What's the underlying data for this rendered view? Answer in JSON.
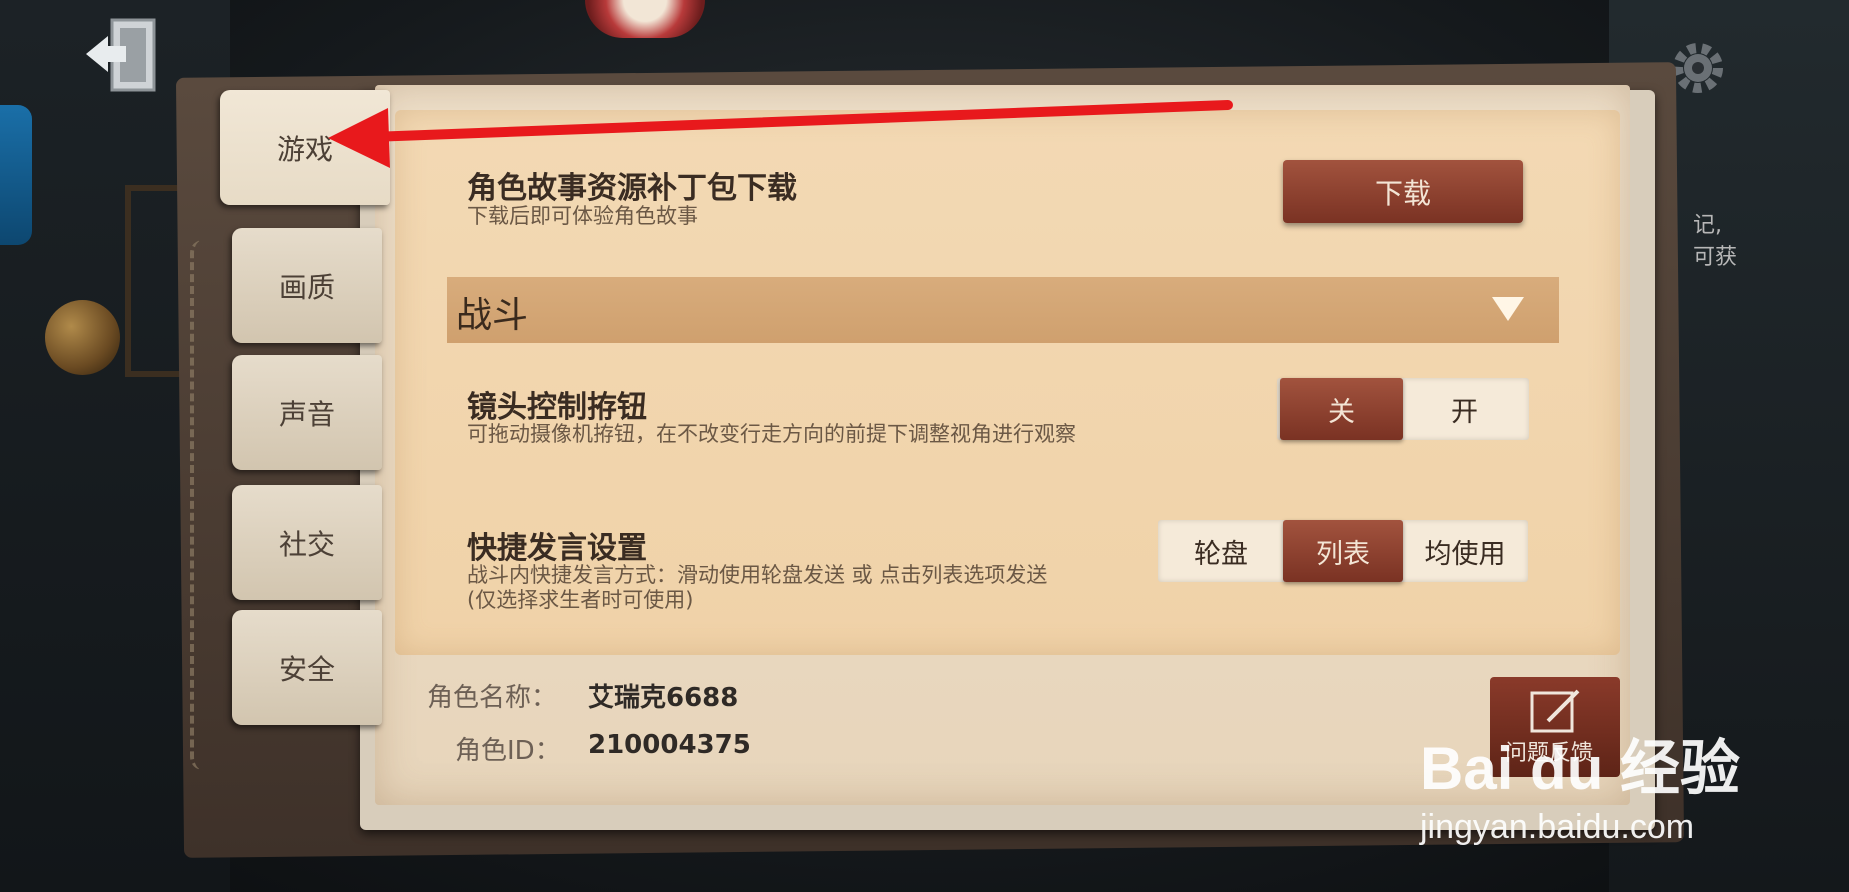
{
  "side_tabs": [
    {
      "label": "游戏",
      "active": true
    },
    {
      "label": "画质",
      "active": false
    },
    {
      "label": "声音",
      "active": false
    },
    {
      "label": "社交",
      "active": false
    },
    {
      "label": "安全",
      "active": false
    }
  ],
  "settings": {
    "story_patch": {
      "title": "角色故事资源补丁包下载",
      "description": "下载后即可体验角色故事",
      "button_label": "下载"
    },
    "section_title": "战斗",
    "camera_joystick": {
      "title": "镜头控制拵钮",
      "description": "可拖动摄像机拵钮，在不改变行走方向的前提下调整视角进行观察",
      "options": [
        "关",
        "开"
      ],
      "selected": "关"
    },
    "quick_chat": {
      "title": "快捷发言设置",
      "description_line1": "战斗内快捷发言方式：滑动使用轮盘发送 或 点击列表选项发送",
      "description_line2": "(仅选择求生者时可使用)",
      "options": [
        "轮盘",
        "列表",
        "均使用"
      ],
      "selected": "列表"
    }
  },
  "footer": {
    "name_label": "角色名称：",
    "name_value": "艾瑞克6688",
    "id_label": "角色ID：",
    "id_value": "210004375",
    "feedback_label": "问题反馈"
  },
  "background": {
    "right_text_line1": "记,",
    "right_text_line2": "可获"
  },
  "watermark": {
    "logo": "Bai du 经验",
    "url": "jingyan.baidu.com"
  },
  "colors": {
    "accent_button": "#8a3a2a",
    "annotation_arrow": "#e8191c",
    "section_bar": "#d4a675"
  }
}
